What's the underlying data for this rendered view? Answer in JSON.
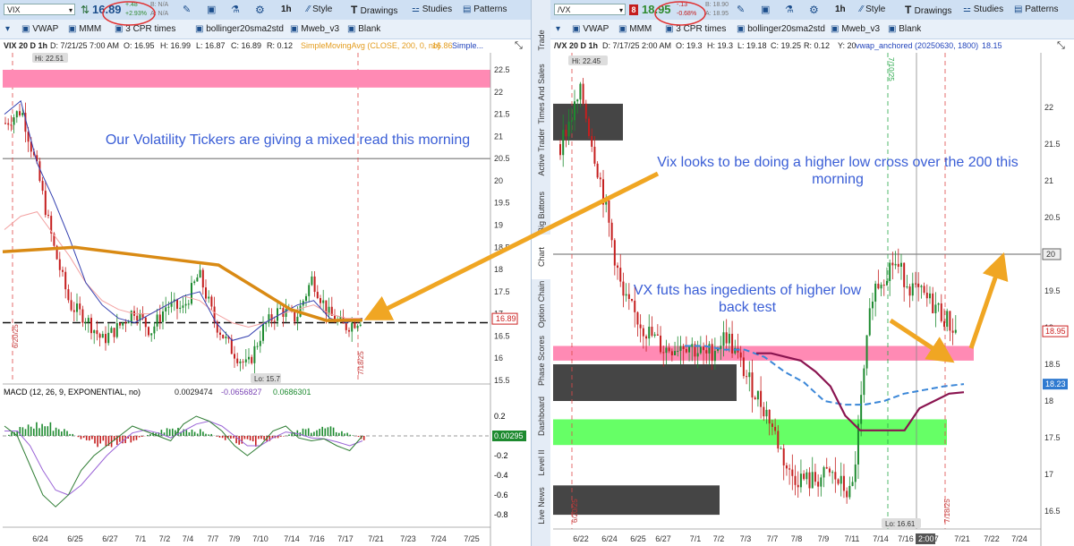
{
  "left": {
    "toolbar": {
      "symbol": "VIX",
      "price": "16.89",
      "change": "+.48",
      "change_pct": "+2.93%",
      "bid": "B: N/A",
      "ask": "A: N/A",
      "interval": "1h",
      "style": "Style",
      "drawings": "Drawings",
      "studies": "Studies",
      "patterns": "Patterns"
    },
    "studybar": [
      "VWAP",
      "MMM",
      "3 CPR times",
      "bollinger20sma2std",
      "Mweb_v3",
      "Blank"
    ],
    "info": {
      "title": "VIX 20 D 1h",
      "date": "D: 7/21/25 7:00 AM",
      "open": "O: 16.95",
      "high": "H: 16.99",
      "low": "L: 16.87",
      "close": "C: 16.89",
      "range": "R: 0.12",
      "sma": "SimpleMovingAvg (CLOSE, 200, 0, no)",
      "sma_val": "16.86",
      "simple": "Simple..."
    }
  },
  "right": {
    "toolbar": {
      "symbol": "/VX",
      "price": "18.95",
      "change": "-.13",
      "change_pct": "-0.68%",
      "bid": "B: 18.90",
      "ask": "A: 18.95",
      "interval": "1h",
      "style": "Style",
      "drawings": "Drawings",
      "studies": "Studies",
      "patterns": "Patterns",
      "badge": "8"
    },
    "studybar": [
      "VWAP",
      "MMM",
      "3 CPR times",
      "bollinger20sma2std",
      "Mweb_v3",
      "Blank"
    ],
    "info": {
      "title": "/VX 20 D 1h",
      "date": "D: 7/17/25 2:00 AM",
      "open": "O: 19.3",
      "high": "H: 19.3",
      "low": "L: 19.18",
      "close": "C: 19.25",
      "range": "R: 0.12",
      "y": "Y: 20",
      "vwap": "vwap_anchored (20250630, 1800)",
      "vwap_val": "18.15"
    }
  },
  "sidebar_tabs": [
    "Trade",
    "Times And Sales",
    "Active Trader",
    "Big Buttons",
    "Chart",
    "Option Chain",
    "Phase Scores",
    "Dashboard",
    "Level II",
    "Live News"
  ],
  "annotations": {
    "left": "Our Volatility Tickers are giving a mixed read this morning",
    "right_top": "Vix looks to be doing a higher low cross over the 200 this morning",
    "right_mid": "VX futs has ingedients of higher low back test"
  },
  "chart_data": [
    {
      "type": "line",
      "title": "VIX 20 D 1h",
      "x": [
        "6/24",
        "6/25",
        "6/27",
        "7/1",
        "7/2",
        "7/4",
        "7/7",
        "7/9",
        "7/10",
        "7/14",
        "7/16",
        "7/17",
        "7/21",
        "7/23",
        "7/24",
        "7/25"
      ],
      "ylim": [
        15.5,
        22.5
      ],
      "y_ticks": [
        "22.5",
        "22",
        "21.5",
        "21",
        "20.5",
        "20",
        "19.5",
        "19",
        "18.5",
        "18",
        "17.5",
        "17",
        "16.5",
        "16",
        "15.5"
      ],
      "series": [
        {
          "values": [
            21.3,
            21.6,
            20.2,
            18.5,
            17.2,
            16.9,
            16.4,
            16.7,
            17.1,
            16.6,
            17.2,
            17.1,
            17.9,
            16.8,
            16.2,
            15.8,
            16.7,
            17.1,
            16.9,
            17.8,
            17.0,
            16.7,
            16.89
          ]
        }
      ],
      "sma200": [
        18.4,
        18.45,
        18.5,
        18.4,
        18.3,
        18.2,
        18.1,
        17.6,
        17.1,
        16.85,
        16.86
      ],
      "hi_label": "Hi: 22.51",
      "lo_label": "Lo: 15.7",
      "last_price": "16.89",
      "resistance_zone": [
        22.1,
        22.5
      ],
      "date_markers": [
        "6/20/25",
        "7/18/25"
      ]
    },
    {
      "type": "bar",
      "title": "MACD (12, 26, 9, EXPONENTIAL, no)",
      "values_header": [
        "0.0029474",
        "-0.0656827",
        "0.0686301"
      ],
      "ylim": [
        -0.8,
        0.2
      ],
      "y_ticks": [
        "0.2",
        "0",
        "-0.2",
        "-0.4",
        "-0.6",
        "-0.8"
      ],
      "last_value": "0.00295"
    },
    {
      "type": "line",
      "title": "/VX 20 D 1h",
      "x": [
        "6/22",
        "6/24",
        "6/25",
        "6/27",
        "7/1",
        "7/2",
        "7/3",
        "7/7",
        "7/8",
        "7/9",
        "7/11",
        "7/14",
        "7/16",
        "7/17",
        "7/21",
        "7/22",
        "7/24"
      ],
      "ylim": [
        16.5,
        22.5
      ],
      "y_ticks": [
        "22",
        "21.5",
        "21",
        "20.5",
        "20",
        "19.5",
        "19",
        "18.5",
        "18",
        "17.5",
        "17",
        "16.5"
      ],
      "series": [
        {
          "values": [
            21.5,
            22.2,
            20.9,
            19.4,
            19.0,
            18.7,
            18.8,
            18.6,
            18.9,
            18.3,
            17.8,
            17.0,
            16.9,
            17.0,
            16.7,
            19.5,
            19.9,
            19.5,
            19.3,
            18.95
          ]
        }
      ],
      "hi_label": "Hi: 22.45",
      "lo_label": "Lo: 16.61",
      "last_price": "18.95",
      "vwap_price": "18.23",
      "ref_line": "20",
      "time_label": "2:00",
      "zones": {
        "pink": [
          18.55,
          18.75
        ],
        "green": [
          17.4,
          17.75
        ],
        "dark": [
          [
            21.55,
            22.05
          ],
          [
            18.0,
            18.5
          ],
          [
            16.45,
            16.85
          ]
        ]
      },
      "date_markers": [
        "6/20/25",
        "7/10/25",
        "7/18/25"
      ]
    }
  ],
  "colors": {
    "pink": "#ff8ab4",
    "green": "#66ff66",
    "dark": "#454545",
    "orange": "#f0a623",
    "annotation": "#3a5ed6"
  }
}
